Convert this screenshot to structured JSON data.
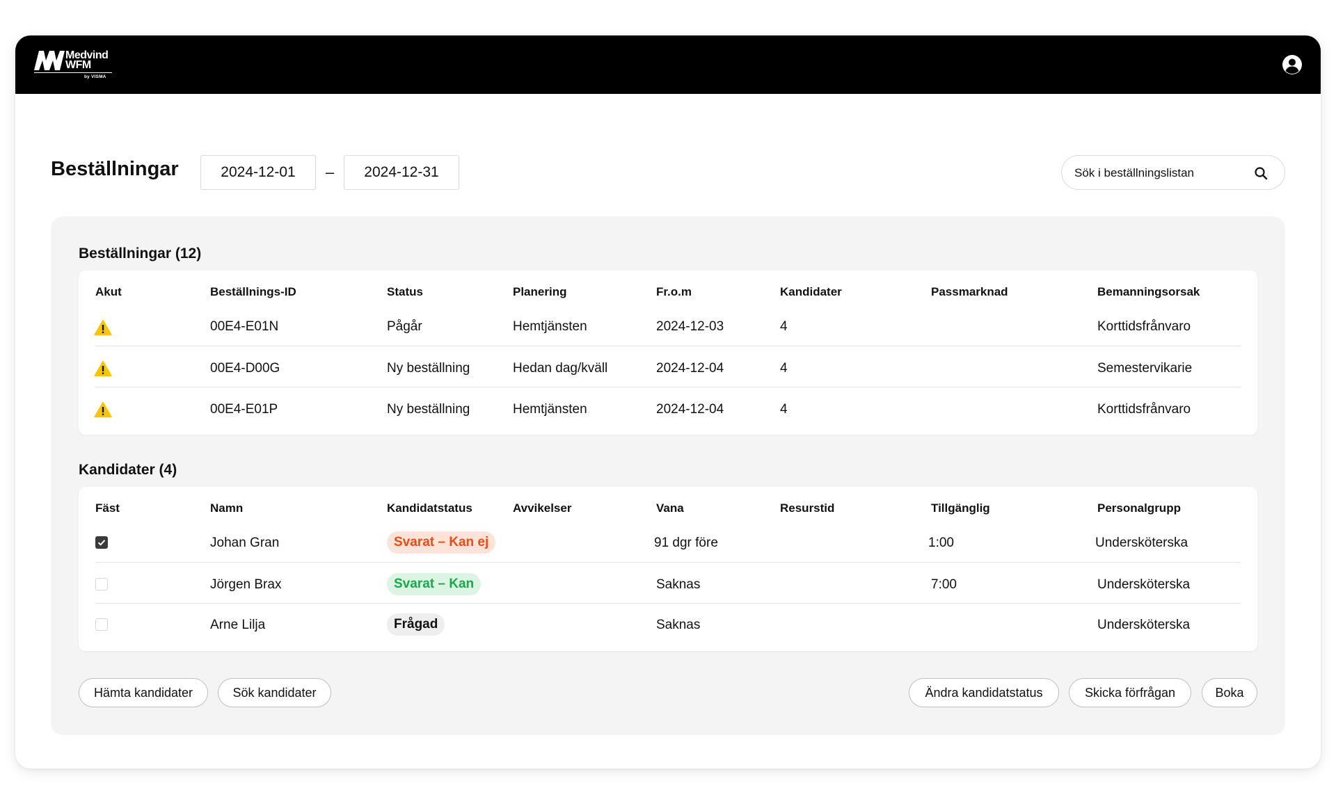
{
  "header": {
    "logo_line1": "Medvind",
    "logo_line2": "WFM",
    "logo_sub": "by VISMA",
    "user_icon": "user-circle-icon"
  },
  "page": {
    "title": "Beställningar",
    "date_from": "2024-12-01",
    "date_separator": "–",
    "date_to": "2024-12-31",
    "search_placeholder": "Sök i beställningslistan"
  },
  "orders": {
    "title": "Beställningar (12)",
    "columns": [
      "Akut",
      "Beställnings-ID",
      "Status",
      "Planering",
      "Fr.o.m",
      "Kandidater",
      "Passmarknad",
      "Bemanningsorsak"
    ],
    "rows": [
      {
        "urgent_icon": "warning-icon",
        "id": "00E4-E01N",
        "status": "Pågår",
        "planning": "Hemtjänsten",
        "from": "2024-12-03",
        "candidates": "4",
        "market": "",
        "reason": "Korttidsfrånvaro"
      },
      {
        "urgent_icon": "warning-icon",
        "id": "00E4-D00G",
        "status": "Ny beställning",
        "planning": "Hedan dag/kväll",
        "from": "2024-12-04",
        "candidates": "4",
        "market": "",
        "reason": "Semestervikarie"
      },
      {
        "urgent_icon": "warning-icon",
        "id": "00E4-E01P",
        "status": "Ny beställning",
        "planning": "Hemtjänsten",
        "from": "2024-12-04",
        "candidates": "4",
        "market": "",
        "reason": "Korttidsfrånvaro"
      }
    ]
  },
  "candidates": {
    "title": "Kandidater (4)",
    "columns": [
      "Fäst",
      "Namn",
      "Kandidatstatus",
      "Avvikelser",
      "Vana",
      "Resurstid",
      "Tillgänglig",
      "Personalgrupp"
    ],
    "rows": [
      {
        "pinned": true,
        "name": "Johan Gran",
        "status": "Svarat – Kan ej",
        "deviations": "",
        "experience": "91 dgr före",
        "resource_time": "",
        "available": "1:00",
        "group": "Undersköterska"
      },
      {
        "pinned": false,
        "name": "Jörgen Brax",
        "status": "Svarat – Kan",
        "deviations": "",
        "experience": "Saknas",
        "resource_time": "",
        "available": "7:00",
        "group": "Undersköterska"
      },
      {
        "pinned": false,
        "name": "Arne Lilja",
        "status": "Frågad",
        "deviations": "",
        "experience": "Saknas",
        "resource_time": "",
        "available": "",
        "group": "Undersköterska"
      }
    ]
  },
  "actions": {
    "fetch_candidates": "Hämta kandidater",
    "search_candidates": "Sök kandidater",
    "change_status": "Ändra kandidatstatus",
    "send_request": "Skicka förfrågan",
    "book": "Boka"
  },
  "colors": {
    "topbar": "#000000",
    "panel": "#f4f4f4",
    "warning": "#f7c600",
    "status_no": "#ee4a16",
    "status_yes": "#17a94a"
  }
}
